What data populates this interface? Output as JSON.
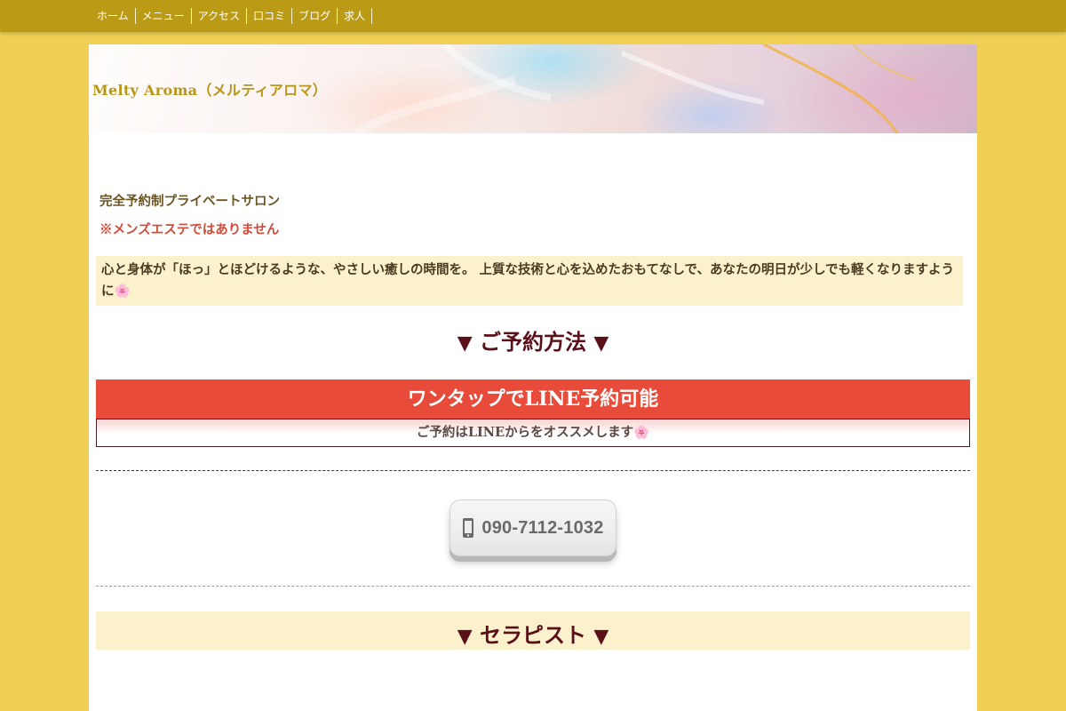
{
  "nav": {
    "items": [
      {
        "label": "ホーム"
      },
      {
        "label": "メニュー"
      },
      {
        "label": "アクセス"
      },
      {
        "label": "口コミ"
      },
      {
        "label": "ブログ"
      },
      {
        "label": "求人"
      }
    ]
  },
  "header": {
    "site_title": "Melty Aroma（メルティアロマ）"
  },
  "main": {
    "tagline": "完全予約制プライベートサロン",
    "notice": "※メンズエステではありません",
    "intro": "心と身体が「ほっ」とほどけるような、やさしい癒しの時間を。 上質な技術と心を込めたおもてなしで、あなたの明日が少しでも軽くなりますように🌸",
    "reservation_heading": {
      "arrow_left": "▼",
      "text": "ご予約方法",
      "arrow_right": "▼"
    },
    "line_box": {
      "title": "ワンタップでLINE予約可能",
      "subtitle": "ご予約はLINEからをオススメします🌸"
    },
    "phone_button": {
      "icon": "smartphone-icon",
      "number": "090-7112-1032"
    },
    "therapist_heading": {
      "arrow_left": "▼",
      "text": "セラピスト",
      "arrow_right": "▼"
    }
  },
  "colors": {
    "page_background": "#f0cf55",
    "nav_background": "#bb9a16",
    "title_gold": "#b7961a",
    "notice_red": "#d14a3a",
    "line_banner_red": "#e94b3a",
    "heading_maroon": "#5a1018",
    "highlight_cream": "#fbf2cd"
  }
}
